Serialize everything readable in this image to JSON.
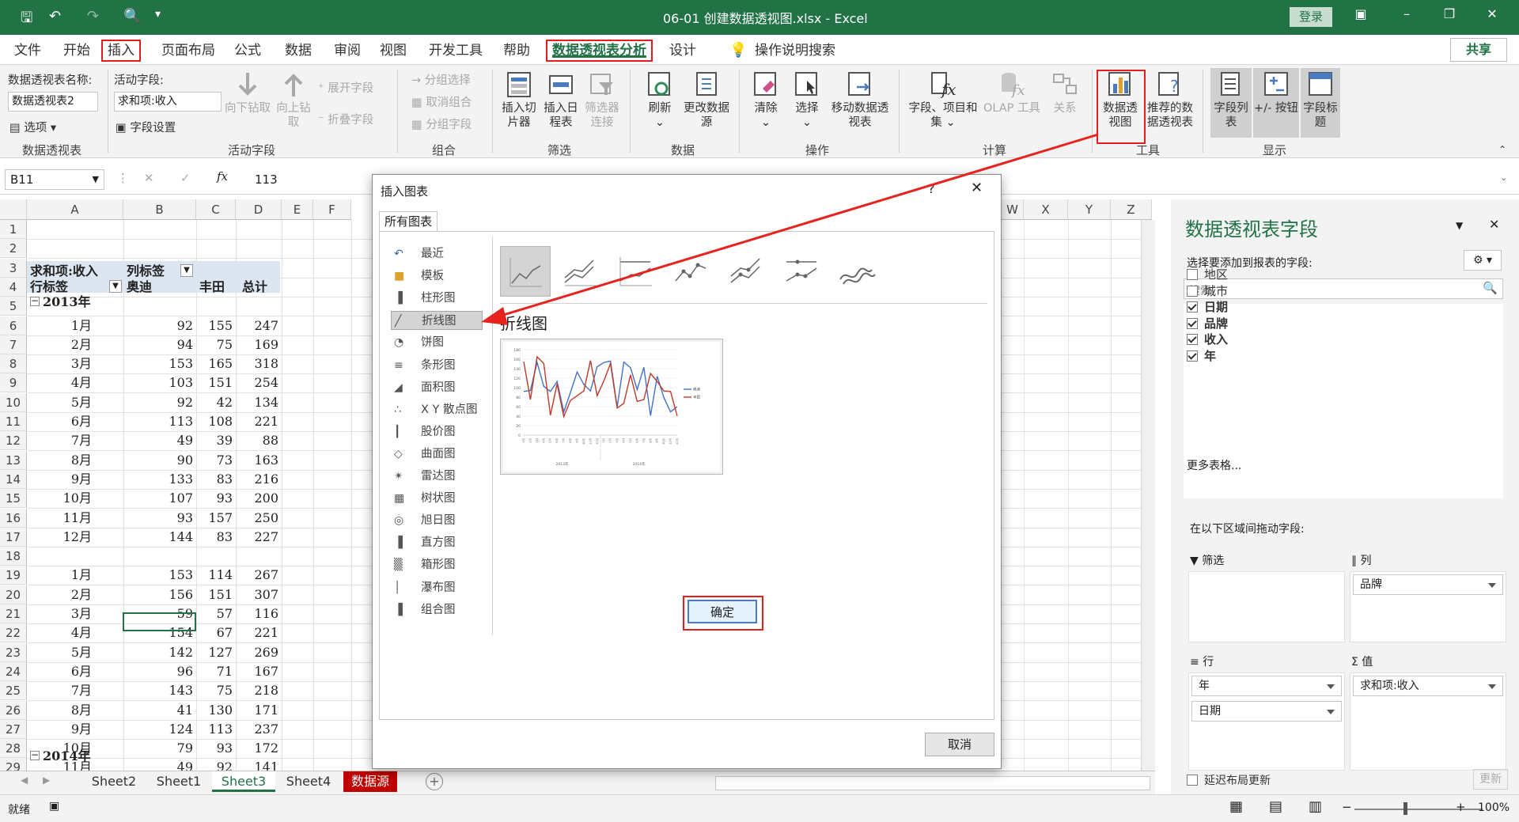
{
  "window": {
    "doc_title": "06-01 创建数据透视图.xlsx  -  Excel",
    "login": "登录",
    "help": "?"
  },
  "tabs": [
    {
      "label": "文件"
    },
    {
      "label": "开始"
    },
    {
      "label": "插入"
    },
    {
      "label": "页面布局"
    },
    {
      "label": "公式"
    },
    {
      "label": "数据"
    },
    {
      "label": "审阅"
    },
    {
      "label": "视图"
    },
    {
      "label": "开发工具"
    },
    {
      "label": "帮助"
    },
    {
      "label": "数据透视表分析"
    },
    {
      "label": "设计"
    }
  ],
  "tell_me": "操作说明搜索",
  "share": "共享",
  "ribbon": {
    "pt_name_label": "数据透视表名称:",
    "pt_name_value": "数据透视表2",
    "options": "选项",
    "group_pt": "数据透视表",
    "active_field_label": "活动字段:",
    "active_field_value": "求和项:收入",
    "field_settings": "字段设置",
    "drill_down": "向下钻取",
    "drill_up": "向上钻取",
    "expand": "展开字段",
    "collapse": "折叠字段",
    "group_active": "活动字段",
    "group_selection": "分组选择",
    "ungroup": "取消组合",
    "group_field": "分组字段",
    "group_group": "组合",
    "insert_slicer": "插入切片器",
    "insert_timeline": "插入日程表",
    "filter_conn": "筛选器连接",
    "group_filter": "筛选",
    "refresh": "刷新",
    "change_source": "更改数据源",
    "group_data": "数据",
    "clear": "清除",
    "select": "选择",
    "move_pt": "移动数据透视表",
    "group_actions": "操作",
    "fields_items": "字段、项目和集",
    "olap": "OLAP 工具",
    "relations": "关系",
    "group_calc": "计算",
    "pivot_chart": "数据透视图",
    "recommended": "推荐的数据透视表",
    "group_tools": "工具",
    "field_list": "字段列表",
    "buttons": "+/- 按钮",
    "field_headers": "字段标题",
    "group_show": "显示"
  },
  "formula_bar": {
    "name_box": "B11",
    "fx": "fx",
    "value": "113"
  },
  "columns": [
    "A",
    "B",
    "C",
    "D",
    "E",
    "F",
    "W",
    "X",
    "Y",
    "Z"
  ],
  "sheet": {
    "header_row3": [
      "求和项:收入",
      "列标签"
    ],
    "header_row4": [
      "行标签",
      "奥迪",
      "丰田",
      "总计"
    ],
    "year2013": "2013年",
    "year2014": "2014年",
    "rows": [
      {
        "r": "6",
        "m": "1月",
        "a": "92",
        "b": "155",
        "t": "247"
      },
      {
        "r": "7",
        "m": "2月",
        "a": "94",
        "b": "75",
        "t": "169"
      },
      {
        "r": "8",
        "m": "3月",
        "a": "153",
        "b": "165",
        "t": "318"
      },
      {
        "r": "9",
        "m": "4月",
        "a": "103",
        "b": "151",
        "t": "254"
      },
      {
        "r": "10",
        "m": "5月",
        "a": "92",
        "b": "42",
        "t": "134"
      },
      {
        "r": "11",
        "m": "6月",
        "a": "113",
        "b": "108",
        "t": "221"
      },
      {
        "r": "12",
        "m": "7月",
        "a": "49",
        "b": "39",
        "t": "88"
      },
      {
        "r": "13",
        "m": "8月",
        "a": "90",
        "b": "73",
        "t": "163"
      },
      {
        "r": "14",
        "m": "9月",
        "a": "133",
        "b": "83",
        "t": "216"
      },
      {
        "r": "15",
        "m": "10月",
        "a": "107",
        "b": "93",
        "t": "200"
      },
      {
        "r": "16",
        "m": "11月",
        "a": "93",
        "b": "157",
        "t": "250"
      },
      {
        "r": "17",
        "m": "12月",
        "a": "144",
        "b": "83",
        "t": "227"
      },
      {
        "r": "19",
        "m": "1月",
        "a": "153",
        "b": "114",
        "t": "267"
      },
      {
        "r": "20",
        "m": "2月",
        "a": "156",
        "b": "151",
        "t": "307"
      },
      {
        "r": "21",
        "m": "3月",
        "a": "59",
        "b": "57",
        "t": "116"
      },
      {
        "r": "22",
        "m": "4月",
        "a": "154",
        "b": "67",
        "t": "221"
      },
      {
        "r": "23",
        "m": "5月",
        "a": "142",
        "b": "127",
        "t": "269"
      },
      {
        "r": "24",
        "m": "6月",
        "a": "96",
        "b": "71",
        "t": "167"
      },
      {
        "r": "25",
        "m": "7月",
        "a": "143",
        "b": "75",
        "t": "218"
      },
      {
        "r": "26",
        "m": "8月",
        "a": "41",
        "b": "130",
        "t": "171"
      },
      {
        "r": "27",
        "m": "9月",
        "a": "124",
        "b": "113",
        "t": "237"
      },
      {
        "r": "28",
        "m": "10月",
        "a": "79",
        "b": "93",
        "t": "172"
      },
      {
        "r": "29",
        "m": "11月",
        "a": "49",
        "b": "92",
        "t": "141"
      }
    ],
    "row_numbers": [
      "1",
      "2",
      "3",
      "4",
      "5",
      "6",
      "7",
      "8",
      "9",
      "10",
      "11",
      "12",
      "13",
      "14",
      "15",
      "16",
      "17",
      "18",
      "19",
      "20",
      "21",
      "22",
      "23",
      "24",
      "25",
      "26",
      "27",
      "28",
      "29"
    ]
  },
  "sheet_tabs": [
    {
      "label": "Sheet2"
    },
    {
      "label": "Sheet1"
    },
    {
      "label": "Sheet3"
    },
    {
      "label": "Sheet4"
    },
    {
      "label": "数据源"
    }
  ],
  "status": {
    "ready": "就绪",
    "zoom": "100%"
  },
  "dialog": {
    "title": "插入图表",
    "tab": "所有图表",
    "types": [
      {
        "label": "最近"
      },
      {
        "label": "模板"
      },
      {
        "label": "柱形图"
      },
      {
        "label": "折线图"
      },
      {
        "label": "饼图"
      },
      {
        "label": "条形图"
      },
      {
        "label": "面积图"
      },
      {
        "label": "X Y 散点图"
      },
      {
        "label": "股价图"
      },
      {
        "label": "曲面图"
      },
      {
        "label": "雷达图"
      },
      {
        "label": "树状图"
      },
      {
        "label": "旭日图"
      },
      {
        "label": "直方图"
      },
      {
        "label": "箱形图"
      },
      {
        "label": "瀑布图"
      },
      {
        "label": "组合图"
      }
    ],
    "selected_name": "折线图",
    "ok": "确定",
    "cancel": "取消"
  },
  "chart_data": {
    "type": "line",
    "categories": [
      "1月",
      "2月",
      "3月",
      "4月",
      "5月",
      "6月",
      "7月",
      "8月",
      "9月",
      "10月",
      "11月",
      "12月",
      "1月",
      "2月",
      "3月",
      "4月",
      "5月",
      "6月",
      "7月",
      "8月",
      "9月",
      "10月",
      "11月",
      "12月"
    ],
    "groups": [
      "2013年",
      "2014年"
    ],
    "series": [
      {
        "name": "奥迪",
        "color": "#4472c4",
        "values": [
          92,
          94,
          153,
          103,
          92,
          113,
          49,
          90,
          133,
          107,
          93,
          144,
          153,
          156,
          59,
          154,
          142,
          96,
          143,
          41,
          124,
          79,
          49,
          60
        ]
      },
      {
        "name": "丰田",
        "color": "#c0392b",
        "values": [
          155,
          75,
          165,
          151,
          42,
          108,
          39,
          73,
          83,
          93,
          157,
          83,
          114,
          151,
          57,
          67,
          127,
          71,
          75,
          130,
          113,
          93,
          92,
          40
        ]
      }
    ],
    "yticks": [
      "0",
      "20",
      "40",
      "60",
      "80",
      "100",
      "120",
      "140",
      "160",
      "180"
    ],
    "ylim": [
      0,
      180
    ]
  },
  "pivot_pane": {
    "title": "数据透视表字段",
    "subtitle": "选择要添加到报表的字段:",
    "search_placeholder": "搜索",
    "fields": [
      {
        "label": "地区",
        "checked": false
      },
      {
        "label": "城市",
        "checked": false
      },
      {
        "label": "日期",
        "checked": true
      },
      {
        "label": "品牌",
        "checked": true
      },
      {
        "label": "收入",
        "checked": true
      },
      {
        "label": "年",
        "checked": true
      }
    ],
    "more_tables": "更多表格...",
    "drag_label": "在以下区域间拖动字段:",
    "filter": "筛选",
    "columns": "列",
    "rows": "行",
    "values": "值",
    "col_item": "品牌",
    "row_item1": "年",
    "row_item2": "日期",
    "val_item": "求和项:收入",
    "defer": "延迟布局更新",
    "update": "更新"
  }
}
